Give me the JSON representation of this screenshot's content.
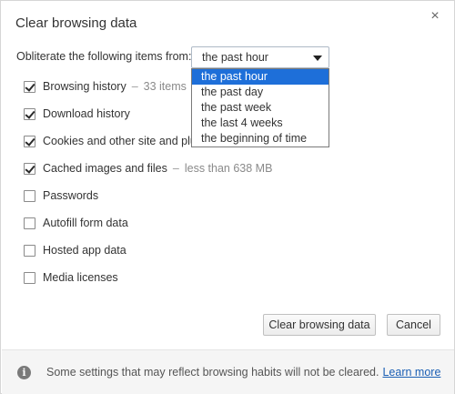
{
  "dialog": {
    "title": "Clear browsing data",
    "close_glyph": "×"
  },
  "period": {
    "label": "Obliterate the following items from:",
    "selected": "the past hour",
    "options": [
      "the past hour",
      "the past day",
      "the past week",
      "the last 4 weeks",
      "the beginning of time"
    ]
  },
  "items": [
    {
      "label": "Browsing history",
      "extra": "33 items",
      "checked": true
    },
    {
      "label": "Download history",
      "extra": "",
      "checked": true
    },
    {
      "label": "Cookies and other site and plugin data",
      "extra": "",
      "checked": true
    },
    {
      "label": "Cached images and files",
      "extra": "less than 638 MB",
      "checked": true
    },
    {
      "label": "Passwords",
      "extra": "",
      "checked": false
    },
    {
      "label": "Autofill form data",
      "extra": "",
      "checked": false
    },
    {
      "label": "Hosted app data",
      "extra": "",
      "checked": false
    },
    {
      "label": "Media licenses",
      "extra": "",
      "checked": false
    }
  ],
  "buttons": {
    "clear": "Clear browsing data",
    "cancel": "Cancel"
  },
  "footer": {
    "text": "Some settings that may reflect browsing habits will not be cleared.",
    "link": "Learn more",
    "icon_glyph": "i"
  },
  "icons": {
    "info": "info-icon",
    "close": "close-icon",
    "caret": "chevron-down-icon"
  }
}
